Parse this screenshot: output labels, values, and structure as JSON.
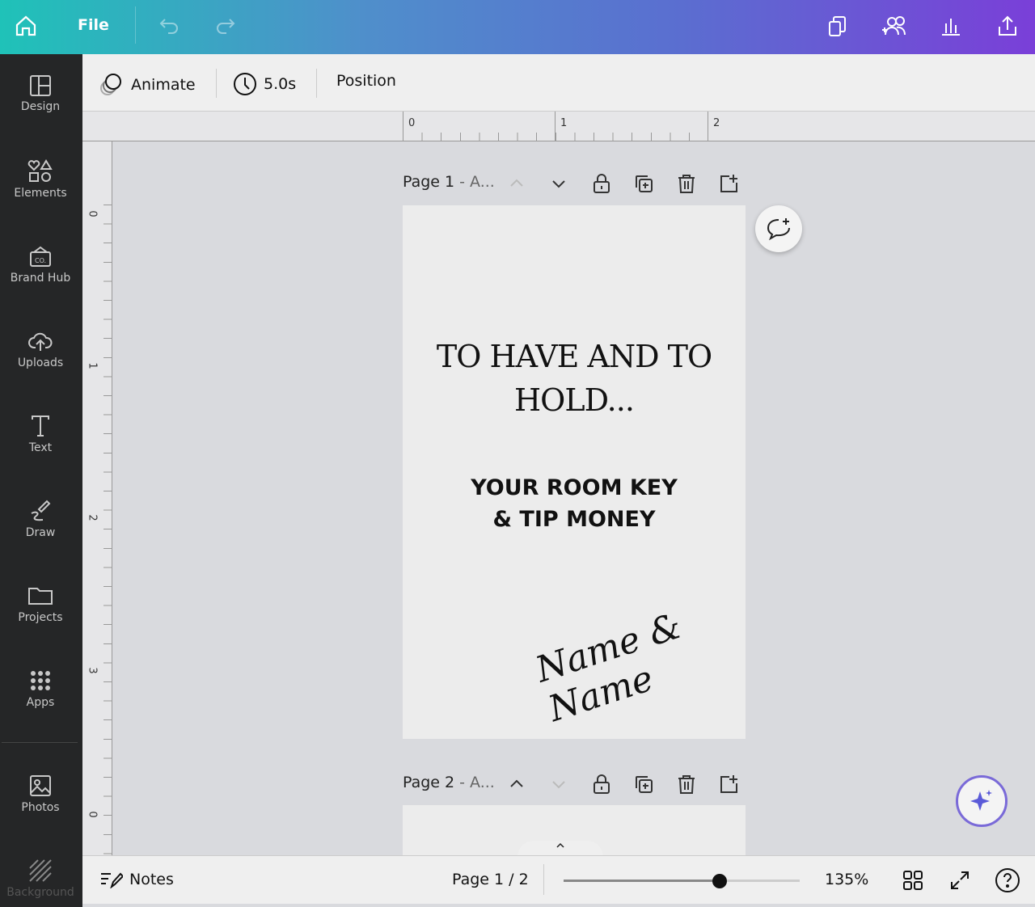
{
  "topbar": {
    "file_label": "File",
    "icons": [
      "home-icon",
      "undo-icon",
      "redo-icon",
      "resize-icon",
      "share-people-icon",
      "insights-icon",
      "upload-icon"
    ]
  },
  "sidebar": {
    "items": [
      {
        "label": "Design",
        "icon": "design-icon"
      },
      {
        "label": "Elements",
        "icon": "elements-icon"
      },
      {
        "label": "Brand Hub",
        "icon": "brand-hub-icon"
      },
      {
        "label": "Uploads",
        "icon": "upload-cloud-icon"
      },
      {
        "label": "Text",
        "icon": "text-icon"
      },
      {
        "label": "Draw",
        "icon": "draw-icon"
      },
      {
        "label": "Projects",
        "icon": "folder-icon"
      },
      {
        "label": "Apps",
        "icon": "apps-icon"
      },
      {
        "label": "Photos",
        "icon": "photos-icon"
      },
      {
        "label": "Background",
        "icon": "background-icon"
      }
    ]
  },
  "toolbar": {
    "animate": "Animate",
    "duration": "5.0s",
    "position": "Position"
  },
  "ruler": {
    "h": [
      "0",
      "1",
      "2"
    ],
    "v": [
      "0",
      "1",
      "2",
      "3",
      "0"
    ]
  },
  "pages": [
    {
      "title_bold": "Page 1",
      "title_rest": " - A..."
    },
    {
      "title_bold": "Page 2",
      "title_rest": " - A..."
    }
  ],
  "design": {
    "heading": "TO HAVE AND TO HOLD...",
    "subheading_line1": "YOUR ROOM KEY",
    "subheading_line2": "& TIP MONEY",
    "signature": "Name & Name"
  },
  "bottom": {
    "notes": "Notes",
    "page_indicator": "Page 1 / 2",
    "zoom": "135%",
    "zoom_slider_percent": 66
  }
}
